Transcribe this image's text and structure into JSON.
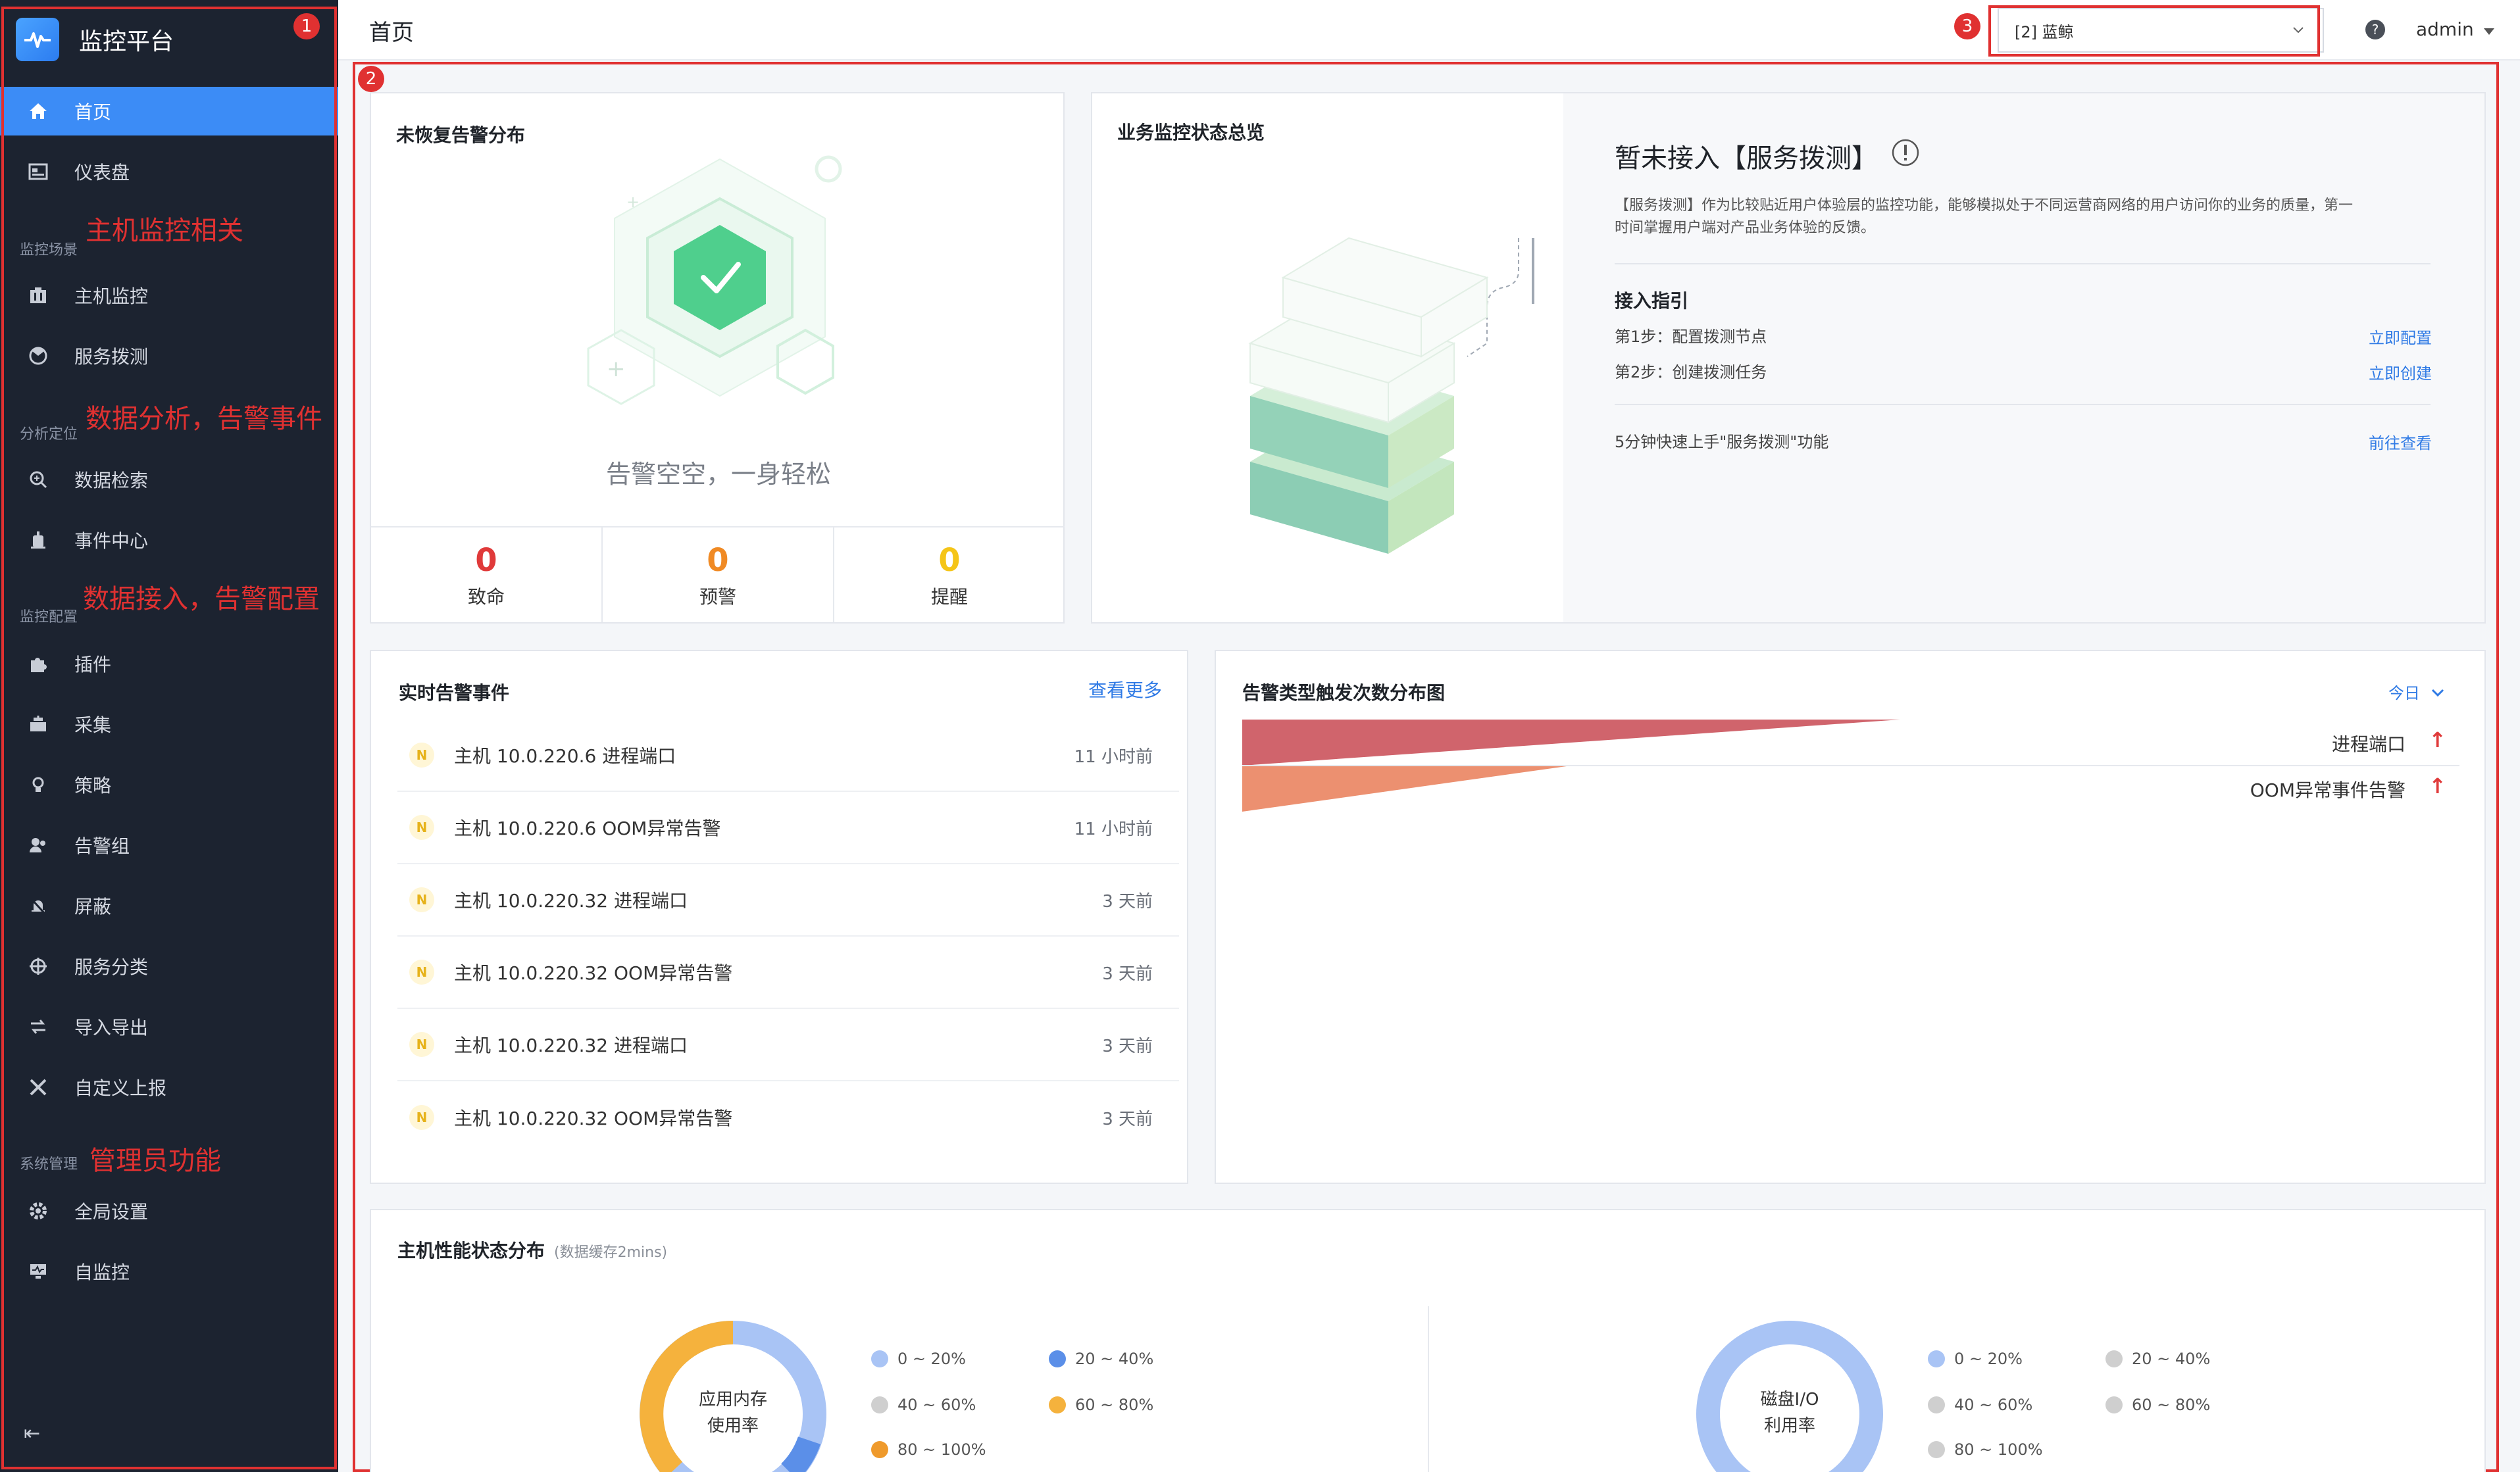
{
  "sidebar": {
    "brand": "监控平台",
    "items": [
      {
        "label": "首页",
        "icon": "home-icon",
        "active": true
      },
      {
        "label": "仪表盘",
        "icon": "dashboard-icon"
      },
      {
        "label": "主机监控",
        "icon": "host-icon"
      },
      {
        "label": "服务拨测",
        "icon": "probe-icon"
      },
      {
        "label": "数据检索",
        "icon": "search-icon"
      },
      {
        "label": "事件中心",
        "icon": "event-icon"
      },
      {
        "label": "插件",
        "icon": "plugin-icon"
      },
      {
        "label": "采集",
        "icon": "collect-icon"
      },
      {
        "label": "策略",
        "icon": "strategy-icon"
      },
      {
        "label": "告警组",
        "icon": "alarm-group-icon"
      },
      {
        "label": "屏蔽",
        "icon": "mute-icon"
      },
      {
        "label": "服务分类",
        "icon": "category-icon"
      },
      {
        "label": "导入导出",
        "icon": "import-export-icon"
      },
      {
        "label": "自定义上报",
        "icon": "custom-report-icon"
      },
      {
        "label": "全局设置",
        "icon": "gear-icon"
      },
      {
        "label": "自监控",
        "icon": "self-monitor-icon"
      }
    ],
    "groups": {
      "scene": "监控场景",
      "analysis": "分析定位",
      "config": "监控配置",
      "system": "系统管理"
    },
    "collapse": "⇤"
  },
  "annotations": {
    "host": "主机监控相关",
    "analysis": "数据分析，告警事件",
    "config": "数据接入，告警配置",
    "admin": "管理员功能",
    "n1": "1",
    "n2": "2",
    "n3": "3"
  },
  "header": {
    "title": "首页",
    "workspace": "[2] 蓝鲸",
    "help": "?",
    "user": "admin"
  },
  "alarm_dist": {
    "title": "未恢复告警分布",
    "empty_text": "告警空空，一身轻松",
    "stats": [
      {
        "num": "0",
        "label": "致命",
        "color": "#e03a3a"
      },
      {
        "num": "0",
        "label": "预警",
        "color": "#f08a24"
      },
      {
        "num": "0",
        "label": "提醒",
        "color": "#f5c518"
      }
    ]
  },
  "biz_overview": {
    "title": "业务监控状态总览",
    "heading": "暂未接入【服务拨测】",
    "desc1": "【服务拨测】作为比较贴近用户体验层的监控功能，能够模拟处于不同运营商网络的用户访问你的业务的质量，第一",
    "desc2": "时间掌握用户端对产品业务体验的反馈。",
    "guide_title": "接入指引",
    "step1": "第1步：配置拨测节点",
    "step1_link": "立即配置",
    "step2": "第2步：创建拨测任务",
    "step2_link": "立即创建",
    "quick": "5分钟快速上手\"服务拨测\"功能",
    "quick_link": "前往查看"
  },
  "events": {
    "title": "实时告警事件",
    "more": "查看更多",
    "rows": [
      {
        "badge": "N",
        "text": "主机 10.0.220.6 进程端口",
        "time": "11 小时前"
      },
      {
        "badge": "N",
        "text": "主机 10.0.220.6 OOM异常告警",
        "time": "11 小时前"
      },
      {
        "badge": "N",
        "text": "主机 10.0.220.32 进程端口",
        "time": "3 天前"
      },
      {
        "badge": "N",
        "text": "主机 10.0.220.32 OOM异常告警",
        "time": "3 天前"
      },
      {
        "badge": "N",
        "text": "主机 10.0.220.32 进程端口",
        "time": "3 天前"
      },
      {
        "badge": "N",
        "text": "主机 10.0.220.32 OOM异常告警",
        "time": "3 天前"
      }
    ]
  },
  "trigger_chart": {
    "title": "告警类型触发次数分布图",
    "range": "今日",
    "bars": [
      {
        "label": "进程端口",
        "color": "#d0646c",
        "fraction": 1.0
      },
      {
        "label": "OOM异常事件告警",
        "color": "#ec9070",
        "fraction": 1.0
      }
    ],
    "trend": "↑"
  },
  "host_perf": {
    "title": "主机性能状态分布",
    "sub": "(数据缓存2mins)",
    "donut1_label1": "应用内存",
    "donut1_label2": "使用率",
    "donut2_label1": "磁盘I/O",
    "donut2_label2": "利用率",
    "legend1": [
      {
        "label": "0 ~ 20%",
        "color": "#a9c4f5"
      },
      {
        "label": "20 ~ 40%",
        "color": "#5b8fe8"
      },
      {
        "label": "40 ~ 60%",
        "color": "#cfcfcf"
      },
      {
        "label": "60 ~ 80%",
        "color": "#f5b23d"
      },
      {
        "label": "80 ~ 100%",
        "color": "#ef9a2c"
      }
    ],
    "legend2": [
      {
        "label": "0 ~ 20%",
        "color": "#a9c4f5"
      },
      {
        "label": "20 ~ 40%",
        "color": "#cfcfcf"
      },
      {
        "label": "40 ~ 60%",
        "color": "#cfcfcf"
      },
      {
        "label": "60 ~ 80%",
        "color": "#cfcfcf"
      },
      {
        "label": "80 ~ 100%",
        "color": "#cfcfcf"
      }
    ]
  }
}
